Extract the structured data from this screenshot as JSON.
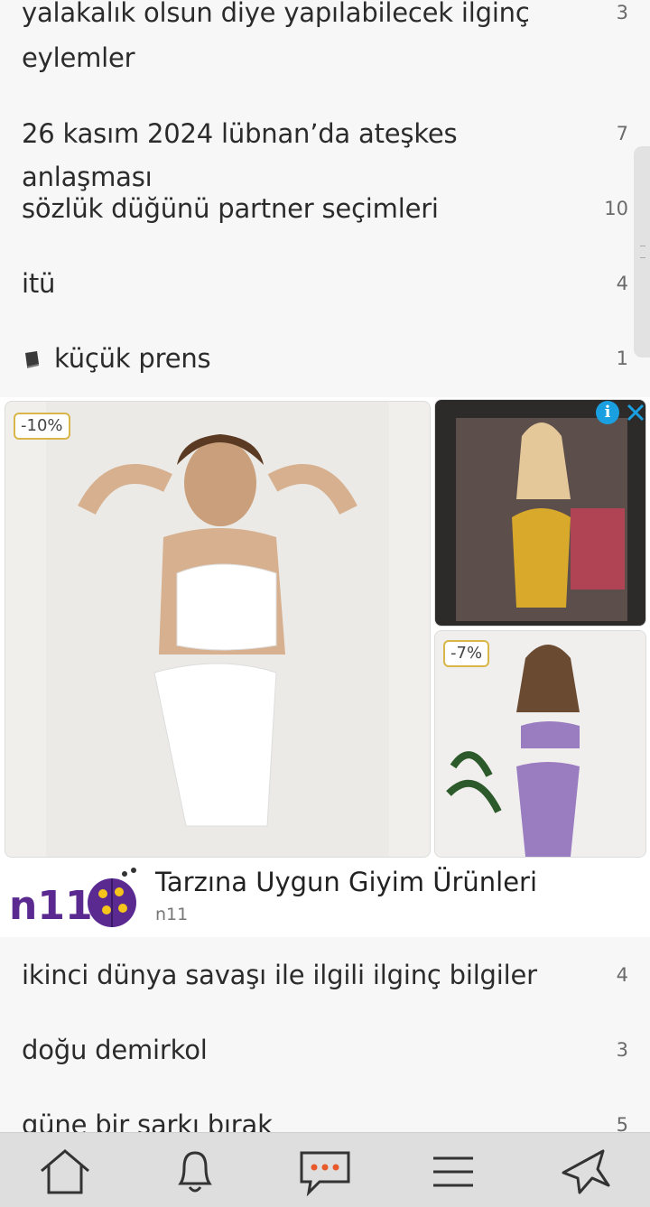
{
  "topics_top": [
    {
      "title_line1": "yalakalık olsun diye yapılabilecek ilginç",
      "title_line2": "eylemler",
      "count": "3"
    },
    {
      "title": "26 kasım 2024 lübnan’da ateşkes anlaşması",
      "count": "7"
    },
    {
      "title": "sözlük düğünü partner seçimleri",
      "count": "10"
    },
    {
      "title": "itü",
      "count": "4"
    },
    {
      "title": "küçük prens",
      "count": "1",
      "icon": "book-icon"
    }
  ],
  "ad": {
    "badge_main": "-10%",
    "badge_second": "-7%",
    "title": "Tarzına Uygun Giyim Ürünleri",
    "source": "n11",
    "logo_text": "n11",
    "info_icon": "info-icon",
    "close_icon": "close-icon"
  },
  "topics_bottom": [
    {
      "title": "ikinci dünya savaşı ile ilgili ilginç bilgiler",
      "count": "4"
    },
    {
      "title": "doğu demirkol",
      "count": "3"
    },
    {
      "title": "güne bir şarkı bırak",
      "count": "5"
    }
  ],
  "nav": [
    "home-icon",
    "bell-icon",
    "messages-icon",
    "menu-icon",
    "plane-icon"
  ],
  "colors": {
    "accent": "#e85a2b",
    "brand_purple": "#5b2a91",
    "brand_yellow": "#f5c51b"
  }
}
